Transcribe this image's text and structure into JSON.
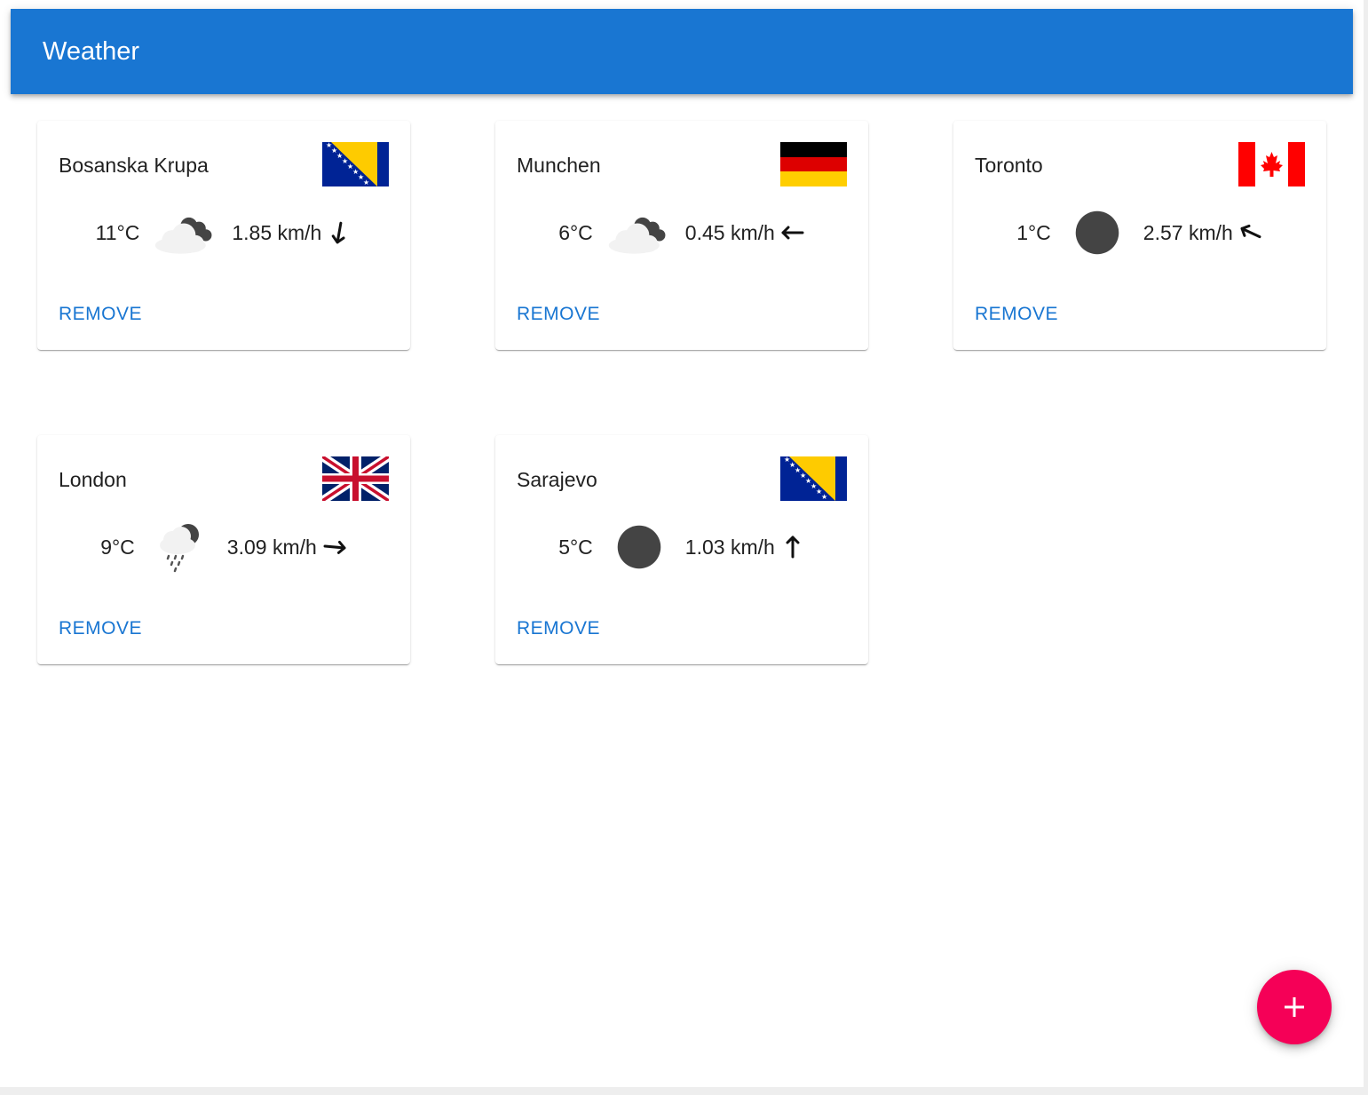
{
  "app": {
    "title": "Weather"
  },
  "colors": {
    "primary": "#1976d2",
    "accent": "#f50057"
  },
  "cards": [
    {
      "city": "Bosanska Krupa",
      "temperature": "11°C",
      "wind": "1.85 km/h",
      "flag": "bosnia-herzegovina-flag",
      "weather_icon": "cloudy-icon",
      "wind_direction": "south",
      "remove_label": "REMOVE"
    },
    {
      "city": "Munchen",
      "temperature": "6°C",
      "wind": "0.45 km/h",
      "flag": "germany-flag",
      "weather_icon": "cloudy-icon",
      "wind_direction": "west",
      "remove_label": "REMOVE"
    },
    {
      "city": "Toronto",
      "temperature": "1°C",
      "wind": "2.57 km/h",
      "flag": "canada-flag",
      "weather_icon": "clear-night-icon",
      "wind_direction": "west-northwest",
      "remove_label": "REMOVE"
    },
    {
      "city": "London",
      "temperature": "9°C",
      "wind": "3.09 km/h",
      "flag": "united-kingdom-flag",
      "weather_icon": "rain-icon",
      "wind_direction": "east",
      "remove_label": "REMOVE"
    },
    {
      "city": "Sarajevo",
      "temperature": "5°C",
      "wind": "1.03 km/h",
      "flag": "bosnia-herzegovina-flag",
      "weather_icon": "clear-night-icon",
      "wind_direction": "north",
      "remove_label": "REMOVE"
    }
  ],
  "fab": {
    "icon": "plus-icon",
    "label": "+"
  }
}
